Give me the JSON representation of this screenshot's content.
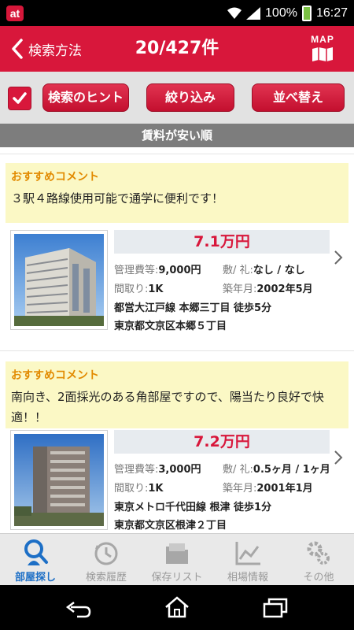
{
  "status": {
    "app_icon": "at",
    "battery": "100%",
    "time": "16:27"
  },
  "header": {
    "back_label": "検索方法",
    "title": "20/427件",
    "map_label": "MAP"
  },
  "toolbar": {
    "hint_label": "検索のヒント",
    "filter_label": "絞り込み",
    "sort_label": "並べ替え"
  },
  "sort_order": "賃料が安い順",
  "listings": [
    {
      "comment_title": "おすすめコメント",
      "comment": "３駅４路線使用可能で通学に便利です！",
      "price": "7.1万円",
      "fee_label": "管理費等:",
      "fee": "9,000円",
      "deposit_label": "敷/ 礼:",
      "deposit": "なし / なし",
      "layout_label": "間取り:",
      "layout": "1K",
      "built_label": "築年月:",
      "built": "2002年5月",
      "station": "都営大江戸線 本郷三丁目 徒歩5分",
      "address": "東京都文京区本郷５丁目"
    },
    {
      "comment_title": "おすすめコメント",
      "comment": "南向き、2面採光のある角部屋ですので、陽当たり良好で快適！！",
      "price": "7.2万円",
      "fee_label": "管理費等:",
      "fee": "3,000円",
      "deposit_label": "敷/ 礼:",
      "deposit": "0.5ヶ月 / 1ヶ月",
      "layout_label": "間取り:",
      "layout": "1K",
      "built_label": "築年月:",
      "built": "2001年1月",
      "station": "東京メトロ千代田線 根津 徒歩1分",
      "address": "東京都文京区根津２丁目"
    }
  ],
  "tabs": [
    {
      "label": "部屋探し",
      "icon": "search-house-icon"
    },
    {
      "label": "検索履歴",
      "icon": "history-clock-icon"
    },
    {
      "label": "保存リスト",
      "icon": "folder-icon"
    },
    {
      "label": "相場情報",
      "icon": "chart-icon"
    },
    {
      "label": "その他",
      "icon": "gear-icon"
    }
  ],
  "colors": {
    "brand": "#d8173b",
    "comment_bg": "#fbf8c5",
    "comment_title": "#e28a00",
    "active_tab": "#1d6fc6"
  }
}
